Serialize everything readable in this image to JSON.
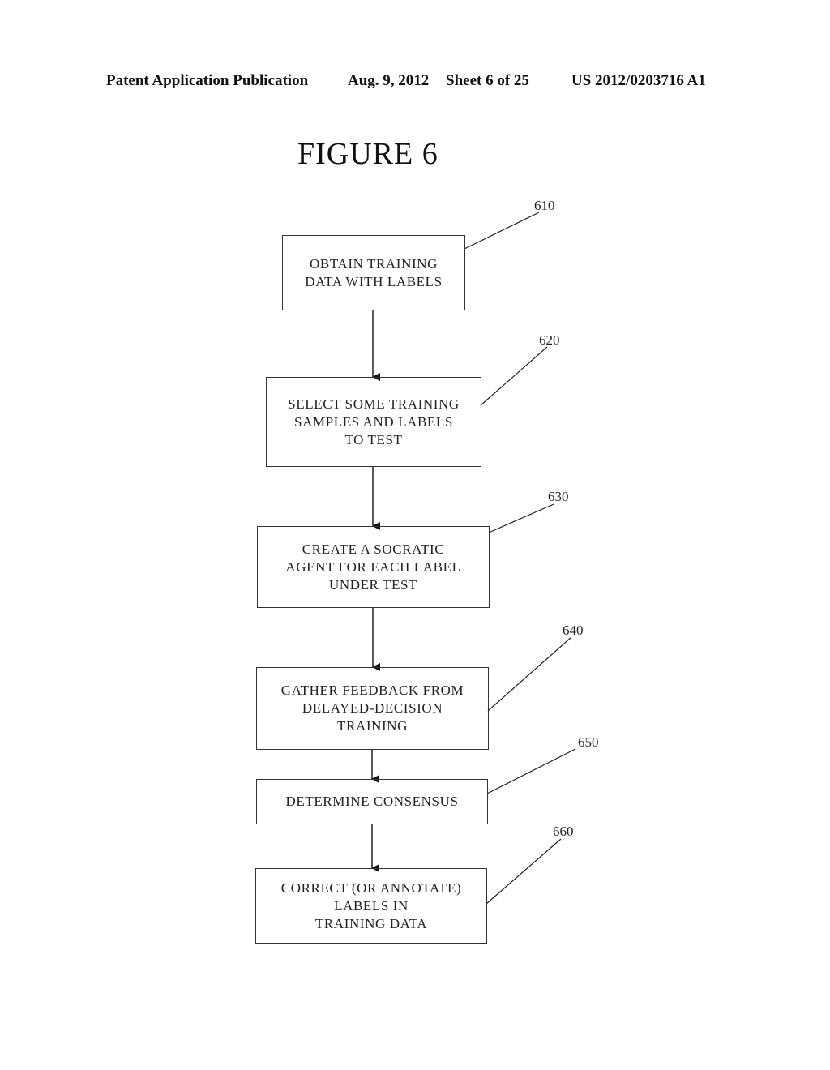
{
  "header": {
    "publication": "Patent Application Publication",
    "date": "Aug. 9, 2012",
    "sheet": "Sheet 6 of 25",
    "number": "US 2012/0203716 A1"
  },
  "figure": {
    "title": "FIGURE 6",
    "steps": [
      {
        "ref": "610",
        "text": "OBTAIN TRAINING\nDATA WITH LABELS"
      },
      {
        "ref": "620",
        "text": "SELECT SOME TRAINING\nSAMPLES AND LABELS\nTO TEST"
      },
      {
        "ref": "630",
        "text": "CREATE A SOCRATIC\nAGENT FOR EACH LABEL\nUNDER TEST"
      },
      {
        "ref": "640",
        "text": "GATHER FEEDBACK FROM\nDELAYED-DECISION\nTRAINING"
      },
      {
        "ref": "650",
        "text": "DETERMINE CONSENSUS"
      },
      {
        "ref": "660",
        "text": "CORRECT (OR ANNOTATE)\nLABELS IN\nTRAINING DATA"
      }
    ]
  }
}
